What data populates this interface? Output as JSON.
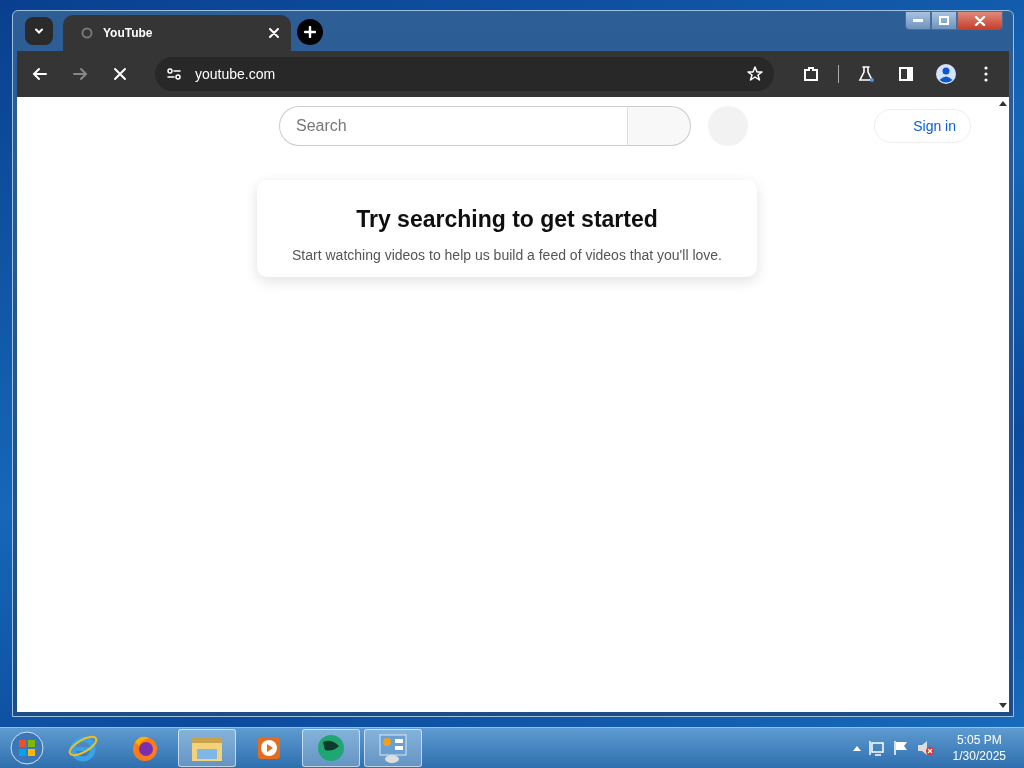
{
  "browser": {
    "tabs": [
      {
        "title": "YouTube",
        "selected": true
      }
    ],
    "address": "youtube.com",
    "loading": true
  },
  "page": {
    "search": {
      "placeholder": "Search"
    },
    "sign_in": "Sign in",
    "card": {
      "title": "Try searching to get started",
      "text": "Start watching videos to help us build a feed of videos that you'll love."
    }
  },
  "taskbar": {
    "items": [
      {
        "kind": "ie",
        "running": false
      },
      {
        "kind": "firefox",
        "running": false
      },
      {
        "kind": "explorer",
        "running": true
      },
      {
        "kind": "media",
        "running": false
      },
      {
        "kind": "globe",
        "running": true
      },
      {
        "kind": "panel",
        "running": true
      }
    ],
    "clock": {
      "time": "5:05 PM",
      "date": "1/30/2025"
    }
  }
}
